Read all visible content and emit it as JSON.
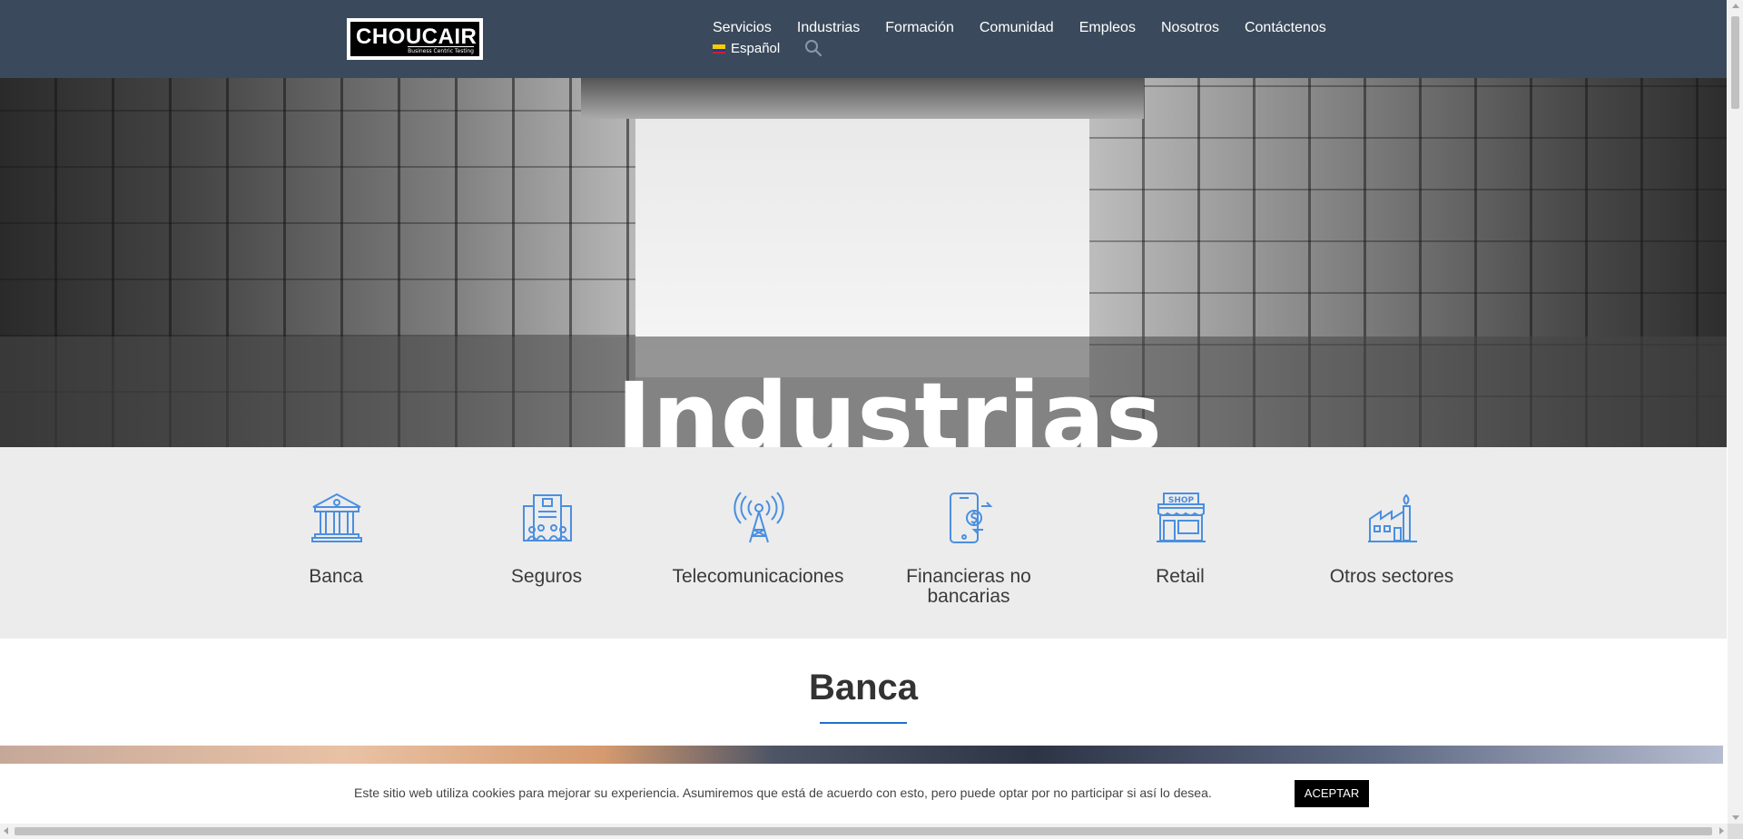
{
  "header": {
    "logo_text": "CHOUCAIR",
    "logo_tagline": "Business Centric Testing",
    "nav": [
      "Servicios",
      "Industrias",
      "Formación",
      "Comunidad",
      "Empleos",
      "Nosotros",
      "Contáctenos"
    ],
    "language": "Español",
    "language_flag": "colombia-flag-icon",
    "search_icon": "search-icon"
  },
  "hero": {
    "title": "Industrias"
  },
  "industries": [
    {
      "label": "Banca",
      "icon": "bank-icon"
    },
    {
      "label": "Seguros",
      "icon": "building-people-icon"
    },
    {
      "label": "Telecomunicaciones",
      "icon": "antenna-tower-icon"
    },
    {
      "label": "Financieras no bancarias",
      "icon": "mobile-payment-icon"
    },
    {
      "label": "Retail",
      "icon": "shop-icon"
    },
    {
      "label": "Otros sectores",
      "icon": "factory-icon"
    }
  ],
  "section": {
    "title": "Banca"
  },
  "cookie": {
    "text": "Este sitio web utiliza cookies para mejorar su experiencia. Asumiremos que está de acuerdo con esto, pero puede optar por no participar si así lo desea.",
    "accept_label": "ACEPTAR"
  },
  "colors": {
    "header_bg": "#3a4a5c",
    "accent_blue": "#1e72c8",
    "icon_blue": "#4a8fe0",
    "strip_bg": "#ececec"
  }
}
